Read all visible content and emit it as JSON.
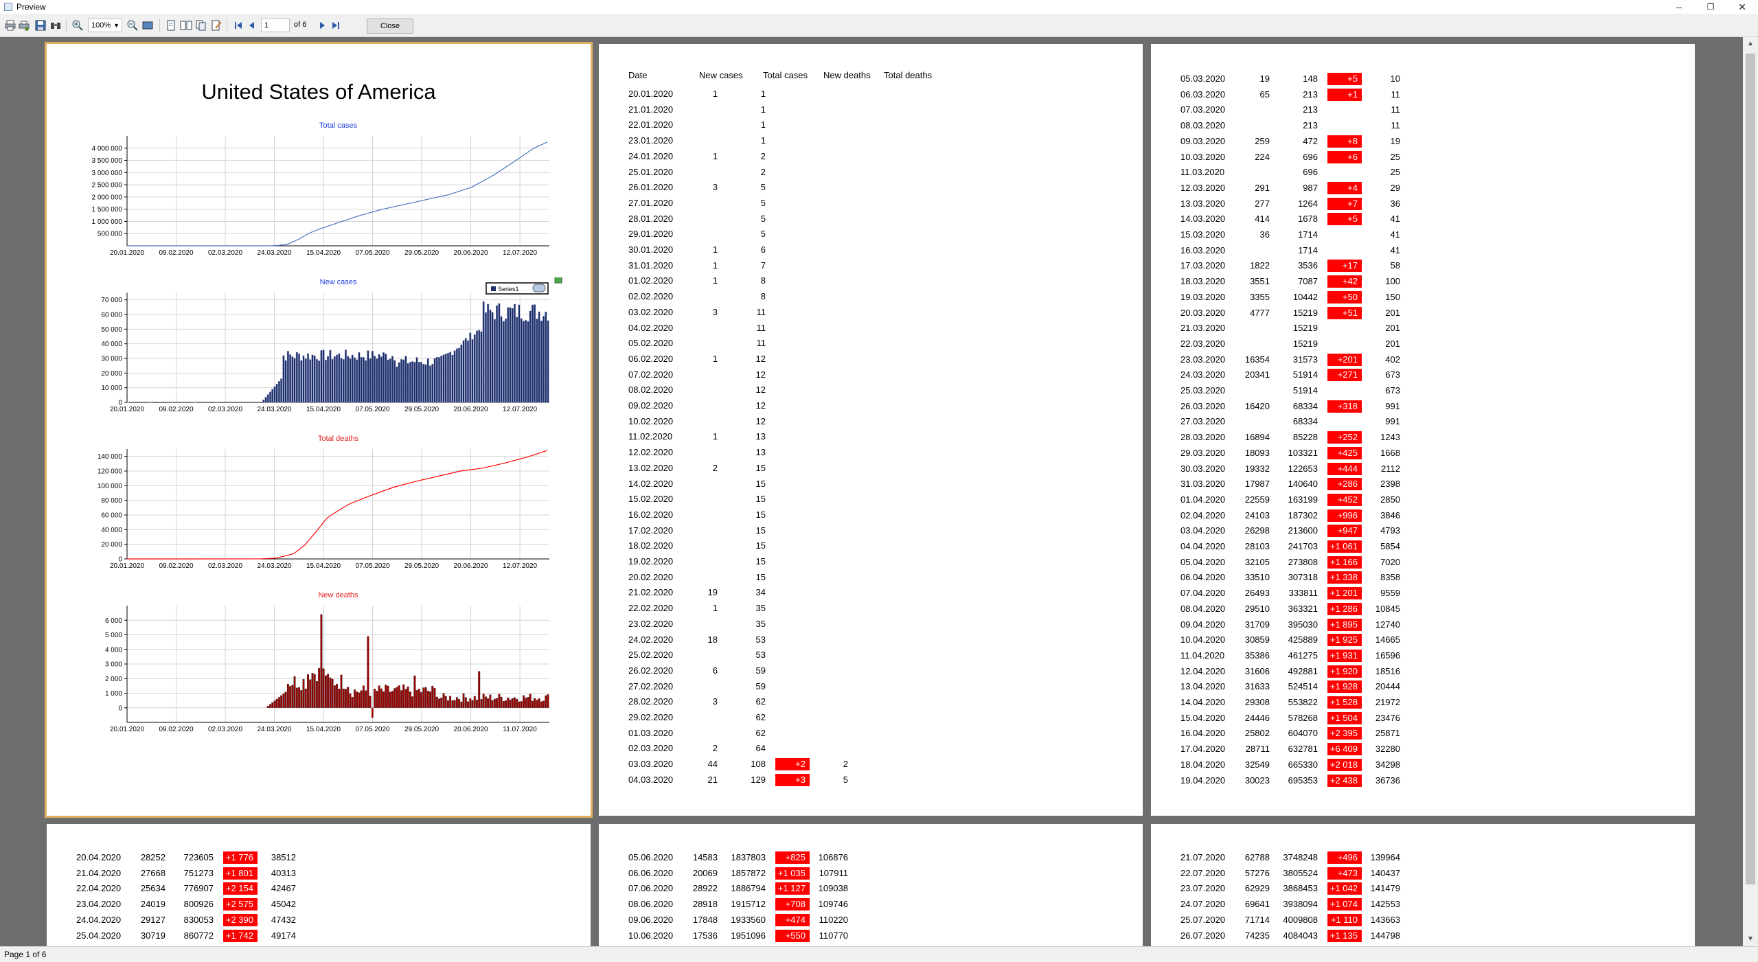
{
  "window": {
    "title": "Preview"
  },
  "toolbar": {
    "zoom": "100%",
    "page": "1",
    "of_pages": "of 6",
    "close_label": "Close"
  },
  "status": {
    "text": "Page 1 of 6"
  },
  "report": {
    "country": "United States of America",
    "headers": {
      "date": "Date",
      "new_cases": "New cases",
      "total_cases": "Total cases",
      "new_deaths": "New deaths",
      "total_deaths": "Total deaths"
    }
  },
  "chart_data": [
    {
      "type": "line",
      "title": "Total cases",
      "title_color": "#1f3fdf",
      "line_color": "#4a72c4",
      "x": [
        "20.01.2020",
        "09.02.2020",
        "02.03.2020",
        "24.03.2020",
        "15.04.2020",
        "07.05.2020",
        "29.05.2020",
        "20.06.2020",
        "12.07.2020"
      ],
      "ylim": [
        0,
        4500000
      ],
      "yticks": [
        "500 000",
        "1 000 000",
        "1 500 000",
        "2 000 000",
        "2 500 000",
        "3 000 000",
        "3 500 000",
        "4 000 000"
      ],
      "series": [
        {
          "values": [
            [
              0,
              0
            ],
            [
              40,
              20
            ],
            [
              60,
              600
            ],
            [
              65,
              3000
            ],
            [
              68,
              15000
            ],
            [
              72,
              60000
            ],
            [
              77,
              260000
            ],
            [
              82,
              520000
            ],
            [
              87,
              700000
            ],
            [
              96,
              980000
            ],
            [
              105,
              1250000
            ],
            [
              115,
              1500000
            ],
            [
              125,
              1700000
            ],
            [
              135,
              1900000
            ],
            [
              145,
              2100000
            ],
            [
              155,
              2400000
            ],
            [
              165,
              2900000
            ],
            [
              175,
              3500000
            ],
            [
              183,
              4000000
            ],
            [
              189,
              4250000
            ]
          ]
        }
      ]
    },
    {
      "type": "bar",
      "title": "New cases",
      "title_color": "#1f3fdf",
      "bar_color": "#1d2d6a",
      "legend": "Series1",
      "x": [
        "20.01.2020",
        "09.02.2020",
        "02.03.2020",
        "24.03.2020",
        "15.04.2020",
        "07.05.2020",
        "29.05.2020",
        "20.06.2020",
        "12.07.2020"
      ],
      "ylim": [
        0,
        75000
      ],
      "yticks": [
        "0",
        "10 000",
        "20 000",
        "30 000",
        "40 000",
        "50 000",
        "60 000",
        "70 000"
      ]
    },
    {
      "type": "line",
      "title": "Total deaths",
      "title_color": "#e0201c",
      "line_color": "#ff0000",
      "x": [
        "20.01.2020",
        "09.02.2020",
        "02.03.2020",
        "24.03.2020",
        "15.04.2020",
        "07.05.2020",
        "29.05.2020",
        "20.06.2020",
        "12.07.2020"
      ],
      "ylim": [
        0,
        150000
      ],
      "yticks": [
        "0",
        "20 000",
        "40 000",
        "60 000",
        "80 000",
        "100 000",
        "120 000",
        "140 000"
      ],
      "series": [
        {
          "values": [
            [
              0,
              0
            ],
            [
              60,
              100
            ],
            [
              67,
              1000
            ],
            [
              75,
              7000
            ],
            [
              80,
              19000
            ],
            [
              85,
              37000
            ],
            [
              90,
              56000
            ],
            [
              95,
              66000
            ],
            [
              100,
              75000
            ],
            [
              110,
              87000
            ],
            [
              120,
              98000
            ],
            [
              130,
              106000
            ],
            [
              140,
              113000
            ],
            [
              150,
              120000
            ],
            [
              160,
              124000
            ],
            [
              170,
              131000
            ],
            [
              180,
              139000
            ],
            [
              189,
              148000
            ]
          ]
        }
      ]
    },
    {
      "type": "bar",
      "title": "New deaths",
      "title_color": "#e0201c",
      "bar_color": "#990000",
      "x": [
        "20.01.2020",
        "09.02.2020",
        "02.03.2020",
        "24.03.2020",
        "15.04.2020",
        "07.05.2020",
        "29.05.2020",
        "20.06.2020",
        "11.07.2020"
      ],
      "ylim": [
        -1000,
        7000
      ],
      "yticks": [
        "0",
        "1 000",
        "2 000",
        "3 000",
        "4 000",
        "5 000",
        "6 000"
      ]
    }
  ],
  "rows": {
    "p2": [
      [
        "20.01.2020",
        "1",
        "1",
        "",
        ""
      ],
      [
        "21.01.2020",
        "",
        "1",
        "",
        ""
      ],
      [
        "22.01.2020",
        "",
        "1",
        "",
        ""
      ],
      [
        "23.01.2020",
        "",
        "1",
        "",
        ""
      ],
      [
        "24.01.2020",
        "1",
        "2",
        "",
        ""
      ],
      [
        "25.01.2020",
        "",
        "2",
        "",
        ""
      ],
      [
        "26.01.2020",
        "3",
        "5",
        "",
        ""
      ],
      [
        "27.01.2020",
        "",
        "5",
        "",
        ""
      ],
      [
        "28.01.2020",
        "",
        "5",
        "",
        ""
      ],
      [
        "29.01.2020",
        "",
        "5",
        "",
        ""
      ],
      [
        "30.01.2020",
        "1",
        "6",
        "",
        ""
      ],
      [
        "31.01.2020",
        "1",
        "7",
        "",
        ""
      ],
      [
        "01.02.2020",
        "1",
        "8",
        "",
        ""
      ],
      [
        "02.02.2020",
        "",
        "8",
        "",
        ""
      ],
      [
        "03.02.2020",
        "3",
        "11",
        "",
        ""
      ],
      [
        "04.02.2020",
        "",
        "11",
        "",
        ""
      ],
      [
        "05.02.2020",
        "",
        "11",
        "",
        ""
      ],
      [
        "06.02.2020",
        "1",
        "12",
        "",
        ""
      ],
      [
        "07.02.2020",
        "",
        "12",
        "",
        ""
      ],
      [
        "08.02.2020",
        "",
        "12",
        "",
        ""
      ],
      [
        "09.02.2020",
        "",
        "12",
        "",
        ""
      ],
      [
        "10.02.2020",
        "",
        "12",
        "",
        ""
      ],
      [
        "11.02.2020",
        "1",
        "13",
        "",
        ""
      ],
      [
        "12.02.2020",
        "",
        "13",
        "",
        ""
      ],
      [
        "13.02.2020",
        "2",
        "15",
        "",
        ""
      ],
      [
        "14.02.2020",
        "",
        "15",
        "",
        ""
      ],
      [
        "15.02.2020",
        "",
        "15",
        "",
        ""
      ],
      [
        "16.02.2020",
        "",
        "15",
        "",
        ""
      ],
      [
        "17.02.2020",
        "",
        "15",
        "",
        ""
      ],
      [
        "18.02.2020",
        "",
        "15",
        "",
        ""
      ],
      [
        "19.02.2020",
        "",
        "15",
        "",
        ""
      ],
      [
        "20.02.2020",
        "",
        "15",
        "",
        ""
      ],
      [
        "21.02.2020",
        "19",
        "34",
        "",
        ""
      ],
      [
        "22.02.2020",
        "1",
        "35",
        "",
        ""
      ],
      [
        "23.02.2020",
        "",
        "35",
        "",
        ""
      ],
      [
        "24.02.2020",
        "18",
        "53",
        "",
        ""
      ],
      [
        "25.02.2020",
        "",
        "53",
        "",
        ""
      ],
      [
        "26.02.2020",
        "6",
        "59",
        "",
        ""
      ],
      [
        "27.02.2020",
        "",
        "59",
        "",
        ""
      ],
      [
        "28.02.2020",
        "3",
        "62",
        "",
        ""
      ],
      [
        "29.02.2020",
        "",
        "62",
        "",
        ""
      ],
      [
        "01.03.2020",
        "",
        "62",
        "",
        ""
      ],
      [
        "02.03.2020",
        "2",
        "64",
        "",
        ""
      ],
      [
        "03.03.2020",
        "44",
        "108",
        "+2",
        "2"
      ],
      [
        "04.03.2020",
        "21",
        "129",
        "+3",
        "5"
      ]
    ],
    "p3": [
      [
        "05.03.2020",
        "19",
        "148",
        "+5",
        "10"
      ],
      [
        "06.03.2020",
        "65",
        "213",
        "+1",
        "11"
      ],
      [
        "07.03.2020",
        "",
        "213",
        "",
        "11"
      ],
      [
        "08.03.2020",
        "",
        "213",
        "",
        "11"
      ],
      [
        "09.03.2020",
        "259",
        "472",
        "+8",
        "19"
      ],
      [
        "10.03.2020",
        "224",
        "696",
        "+6",
        "25"
      ],
      [
        "11.03.2020",
        "",
        "696",
        "",
        "25"
      ],
      [
        "12.03.2020",
        "291",
        "987",
        "+4",
        "29"
      ],
      [
        "13.03.2020",
        "277",
        "1264",
        "+7",
        "36"
      ],
      [
        "14.03.2020",
        "414",
        "1678",
        "+5",
        "41"
      ],
      [
        "15.03.2020",
        "36",
        "1714",
        "",
        "41"
      ],
      [
        "16.03.2020",
        "",
        "1714",
        "",
        "41"
      ],
      [
        "17.03.2020",
        "1822",
        "3536",
        "+17",
        "58"
      ],
      [
        "18.03.2020",
        "3551",
        "7087",
        "+42",
        "100"
      ],
      [
        "19.03.2020",
        "3355",
        "10442",
        "+50",
        "150"
      ],
      [
        "20.03.2020",
        "4777",
        "15219",
        "+51",
        "201"
      ],
      [
        "21.03.2020",
        "",
        "15219",
        "",
        "201"
      ],
      [
        "22.03.2020",
        "",
        "15219",
        "",
        "201"
      ],
      [
        "23.03.2020",
        "16354",
        "31573",
        "+201",
        "402"
      ],
      [
        "24.03.2020",
        "20341",
        "51914",
        "+271",
        "673"
      ],
      [
        "25.03.2020",
        "",
        "51914",
        "",
        "673"
      ],
      [
        "26.03.2020",
        "16420",
        "68334",
        "+318",
        "991"
      ],
      [
        "27.03.2020",
        "",
        "68334",
        "",
        "991"
      ],
      [
        "28.03.2020",
        "16894",
        "85228",
        "+252",
        "1243"
      ],
      [
        "29.03.2020",
        "18093",
        "103321",
        "+425",
        "1668"
      ],
      [
        "30.03.2020",
        "19332",
        "122653",
        "+444",
        "2112"
      ],
      [
        "31.03.2020",
        "17987",
        "140640",
        "+286",
        "2398"
      ],
      [
        "01.04.2020",
        "22559",
        "163199",
        "+452",
        "2850"
      ],
      [
        "02.04.2020",
        "24103",
        "187302",
        "+996",
        "3846"
      ],
      [
        "03.04.2020",
        "26298",
        "213600",
        "+947",
        "4793"
      ],
      [
        "04.04.2020",
        "28103",
        "241703",
        "+1 061",
        "5854"
      ],
      [
        "05.04.2020",
        "32105",
        "273808",
        "+1 166",
        "7020"
      ],
      [
        "06.04.2020",
        "33510",
        "307318",
        "+1 338",
        "8358"
      ],
      [
        "07.04.2020",
        "26493",
        "333811",
        "+1 201",
        "9559"
      ],
      [
        "08.04.2020",
        "29510",
        "363321",
        "+1 286",
        "10845"
      ],
      [
        "09.04.2020",
        "31709",
        "395030",
        "+1 895",
        "12740"
      ],
      [
        "10.04.2020",
        "30859",
        "425889",
        "+1 925",
        "14665"
      ],
      [
        "11.04.2020",
        "35386",
        "461275",
        "+1 931",
        "16596"
      ],
      [
        "12.04.2020",
        "31606",
        "492881",
        "+1 920",
        "18516"
      ],
      [
        "13.04.2020",
        "31633",
        "524514",
        "+1 928",
        "20444"
      ],
      [
        "14.04.2020",
        "29308",
        "553822",
        "+1 528",
        "21972"
      ],
      [
        "15.04.2020",
        "24446",
        "578268",
        "+1 504",
        "23476"
      ],
      [
        "16.04.2020",
        "25802",
        "604070",
        "+2 395",
        "25871"
      ],
      [
        "17.04.2020",
        "28711",
        "632781",
        "+6 409",
        "32280"
      ],
      [
        "18.04.2020",
        "32549",
        "665330",
        "+2 018",
        "34298"
      ],
      [
        "19.04.2020",
        "30023",
        "695353",
        "+2 438",
        "36736"
      ]
    ],
    "p4": [
      [
        "20.04.2020",
        "28252",
        "723605",
        "+1 776",
        "38512"
      ],
      [
        "21.04.2020",
        "27668",
        "751273",
        "+1 801",
        "40313"
      ],
      [
        "22.04.2020",
        "25634",
        "776907",
        "+2 154",
        "42467"
      ],
      [
        "23.04.2020",
        "24019",
        "800926",
        "+2 575",
        "45042"
      ],
      [
        "24.04.2020",
        "29127",
        "830053",
        "+2 390",
        "47432"
      ],
      [
        "25.04.2020",
        "30719",
        "860772",
        "+1 742",
        "49174"
      ]
    ],
    "p5": [
      [
        "05.06.2020",
        "14583",
        "1837803",
        "+825",
        "106876"
      ],
      [
        "06.06.2020",
        "20069",
        "1857872",
        "+1 035",
        "107911"
      ],
      [
        "07.06.2020",
        "28922",
        "1886794",
        "+1 127",
        "109038"
      ],
      [
        "08.06.2020",
        "28918",
        "1915712",
        "+708",
        "109746"
      ],
      [
        "09.06.2020",
        "17848",
        "1933560",
        "+474",
        "110220"
      ],
      [
        "10.06.2020",
        "17536",
        "1951096",
        "+550",
        "110770"
      ]
    ],
    "p6": [
      [
        "21.07.2020",
        "62788",
        "3748248",
        "+496",
        "139964"
      ],
      [
        "22.07.2020",
        "57276",
        "3805524",
        "+473",
        "140437"
      ],
      [
        "23.07.2020",
        "62929",
        "3868453",
        "+1 042",
        "141479"
      ],
      [
        "24.07.2020",
        "69641",
        "3938094",
        "+1 074",
        "142553"
      ],
      [
        "25.07.2020",
        "71714",
        "4009808",
        "+1 110",
        "143663"
      ],
      [
        "26.07.2020",
        "74235",
        "4084043",
        "+1 135",
        "144798"
      ]
    ]
  }
}
